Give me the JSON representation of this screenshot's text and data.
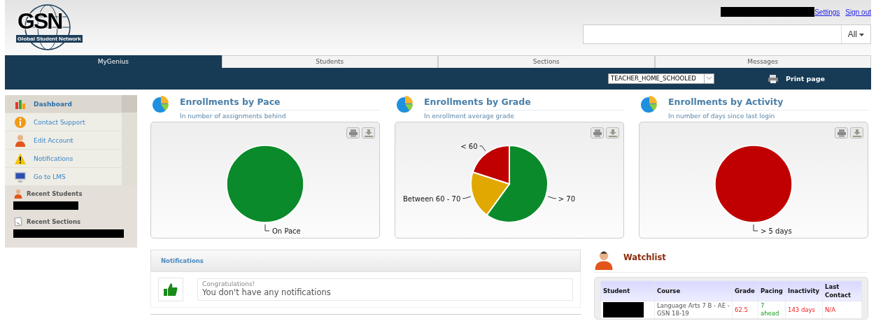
{
  "logo": {
    "title": "GSN",
    "subtitle": "Global Student Network"
  },
  "header": {
    "links": [
      "Settings",
      "Sign out"
    ],
    "search": {
      "scope": "All"
    }
  },
  "tabs": [
    {
      "label": "MyGenius",
      "selected": true
    },
    {
      "label": "Students",
      "selected": false
    },
    {
      "label": "Sections",
      "selected": false
    },
    {
      "label": "Messages",
      "selected": false
    }
  ],
  "toolbar": {
    "role": "TEACHER_HOME_SCHOOLED",
    "print": "Print page"
  },
  "sidebar": {
    "items": [
      {
        "label": "Dashboard",
        "kind": "chart",
        "selected": true
      },
      {
        "label": "Contact Support",
        "kind": "info",
        "selected": false
      },
      {
        "label": "Edit Account",
        "kind": "person",
        "selected": false
      },
      {
        "label": "Notifications",
        "kind": "warning",
        "selected": false
      },
      {
        "label": "Go to LMS",
        "kind": "monitor",
        "selected": false
      }
    ],
    "sections": [
      {
        "title": "Recent Students",
        "kind": "person"
      },
      {
        "title": "Recent Sections",
        "kind": "paper"
      }
    ]
  },
  "charts": [
    {
      "title": "Enrollments by Pace",
      "subtitle": "In number of assignments behind",
      "chart_data": {
        "type": "pie",
        "categories": [
          "On Pace"
        ],
        "values": [
          1
        ],
        "colors": [
          "#0a8a2a"
        ]
      }
    },
    {
      "title": "Enrollments by Grade",
      "subtitle": "In enrollment average grade",
      "chart_data": {
        "type": "pie",
        "categories": [
          "> 70",
          "Between 60 - 70",
          "< 60"
        ],
        "values": [
          60,
          20,
          20
        ],
        "colors": [
          "#0a8a2a",
          "#e0a800",
          "#c00000"
        ]
      }
    },
    {
      "title": "Enrollments by Activity",
      "subtitle": "In number of days since last login",
      "chart_data": {
        "type": "pie",
        "categories": [
          "> 5 days"
        ],
        "values": [
          1
        ],
        "colors": [
          "#c00000"
        ]
      }
    }
  ],
  "notifications": {
    "title": "Notifications",
    "heading": "Congratulations!",
    "message": "You don't have any notifications"
  },
  "watchlist": {
    "title": "Watchlist",
    "columns": [
      "Student",
      "Course",
      "Grade",
      "Pacing",
      "Inactivity",
      "Last Contact"
    ],
    "rows": [
      {
        "cells": [
          {
            "kind": "redacted"
          },
          {
            "kind": "text",
            "text": "Language Arts 7 B - AE - GSN 18-19"
          },
          {
            "kind": "alert",
            "text": "62.5"
          },
          {
            "kind": "ok",
            "text": "7 ahead"
          },
          {
            "kind": "alert",
            "text": "143 days"
          },
          {
            "kind": "alert",
            "text": "N/A"
          }
        ]
      }
    ]
  }
}
